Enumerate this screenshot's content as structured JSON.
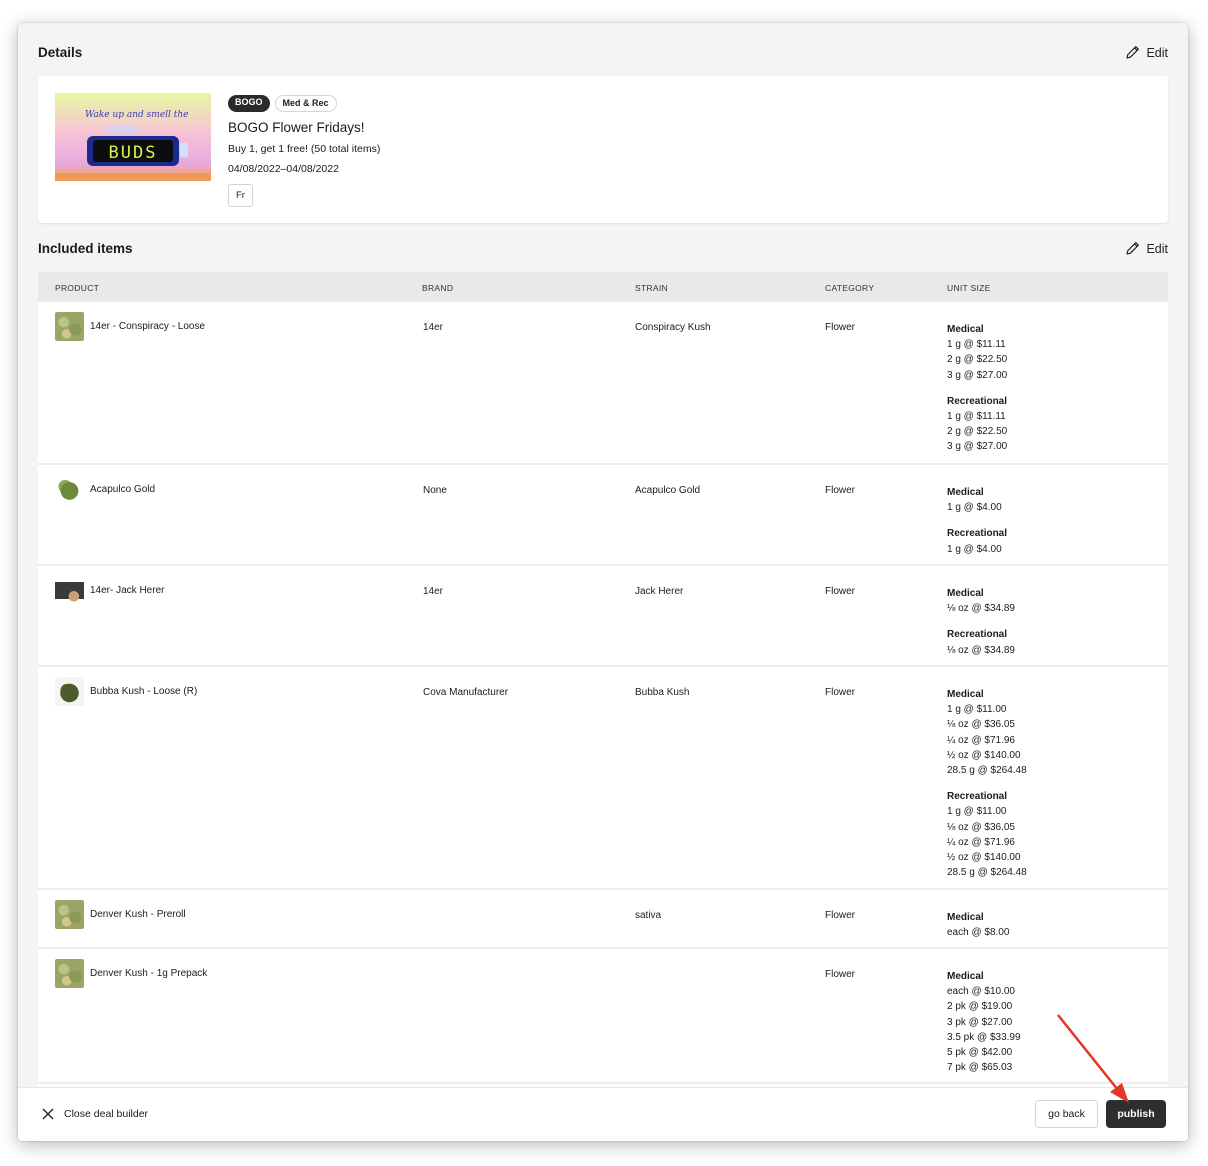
{
  "details": {
    "title": "Details",
    "edit_label": "Edit",
    "promo": {
      "image_text": "BUDS",
      "image_script": "Wake up and smell the",
      "badges": [
        "BOGO",
        "Med & Rec"
      ],
      "title": "BOGO Flower Fridays!",
      "description": "Buy 1, get 1 free! (50 total items)",
      "date_range": "04/08/2022–04/08/2022",
      "day": "Fr"
    }
  },
  "included": {
    "title": "Included items",
    "edit_label": "Edit",
    "columns": [
      "PRODUCT",
      "BRAND",
      "STRAIN",
      "CATEGORY",
      "UNIT SIZE"
    ],
    "rows": [
      {
        "product": "14er - Conspiracy - Loose",
        "brand": "14er",
        "strain": "Conspiracy Kush",
        "category": "Flower",
        "units": [
          {
            "label": "Medical",
            "prices": [
              "1 g @ $11.11",
              "2 g @ $22.50",
              "3 g @ $27.00"
            ]
          },
          {
            "label": "Recreational",
            "prices": [
              "1 g @ $11.11",
              "2 g @ $22.50",
              "3 g @ $27.00"
            ]
          }
        ]
      },
      {
        "product": "Acapulco Gold",
        "brand": "None",
        "strain": "Acapulco Gold",
        "category": "Flower",
        "units": [
          {
            "label": "Medical",
            "prices": [
              "1 g @ $4.00"
            ]
          },
          {
            "label": "Recreational",
            "prices": [
              "1 g @ $4.00"
            ]
          }
        ]
      },
      {
        "product": "14er- Jack Herer",
        "brand": "14er",
        "strain": "Jack Herer",
        "category": "Flower",
        "units": [
          {
            "label": "Medical",
            "prices": [
              "⅛ oz @ $34.89"
            ]
          },
          {
            "label": "Recreational",
            "prices": [
              "⅛ oz @ $34.89"
            ]
          }
        ]
      },
      {
        "product": "Bubba Kush - Loose (R)",
        "brand": "Cova Manufacturer",
        "strain": "Bubba Kush",
        "category": "Flower",
        "units": [
          {
            "label": "Medical",
            "prices": [
              "1 g @ $11.00",
              "⅛ oz @ $36.05",
              "¼ oz @ $71.96",
              "½ oz @ $140.00",
              "28.5 g @ $264.48"
            ]
          },
          {
            "label": "Recreational",
            "prices": [
              "1 g @ $11.00",
              "⅛ oz @ $36.05",
              "¼ oz @ $71.96",
              "½ oz @ $140.00",
              "28.5 g @ $264.48"
            ]
          }
        ]
      },
      {
        "product": "Denver Kush - Preroll",
        "brand": "",
        "strain": "sativa",
        "category": "Flower",
        "units": [
          {
            "label": "Medical",
            "prices": [
              "each @ $8.00"
            ]
          }
        ]
      },
      {
        "product": "Denver Kush - 1g Prepack",
        "brand": "",
        "strain": "",
        "category": "Flower",
        "units": [
          {
            "label": "Medical",
            "prices": [
              "each @ $10.00",
              "2 pk @ $19.00",
              "3 pk @ $27.00",
              "3.5 pk @ $33.99",
              "5 pk @ $42.00",
              "7 pk @ $65.03"
            ]
          }
        ]
      }
    ]
  },
  "footer": {
    "close_label": "Close deal builder",
    "go_back_label": "go back",
    "publish_label": "publish"
  },
  "colors": {
    "accent_dark": "#2e2e2e",
    "annotation_arrow": "#e53524"
  }
}
